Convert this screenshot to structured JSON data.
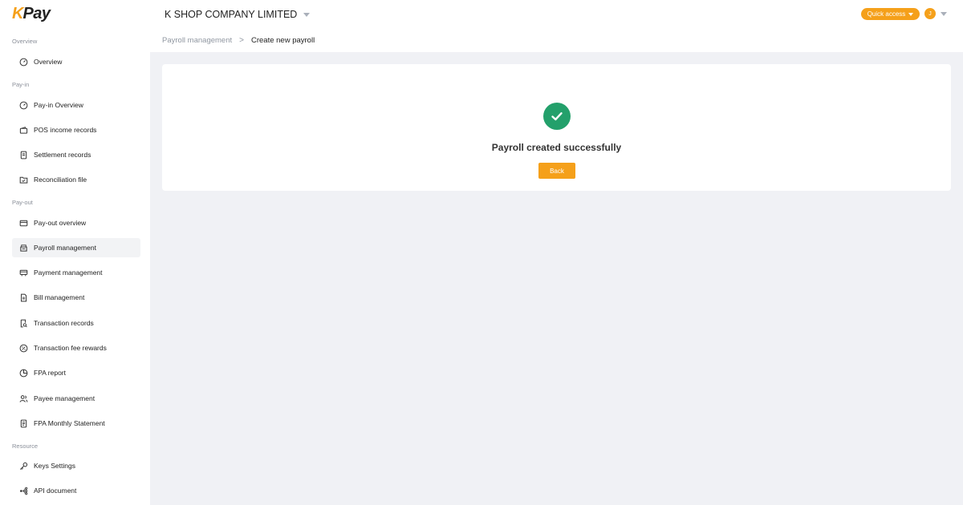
{
  "brand": {
    "logo_k": "K",
    "logo_pay": "Pay",
    "accent": "#f5a01a"
  },
  "header": {
    "company": "K SHOP COMPANY LIMITED",
    "quick_access": "Quick access",
    "avatar_initial": "J"
  },
  "breadcrumb": {
    "parent": "Payroll management",
    "separator": ">",
    "current": "Create new payroll"
  },
  "sidebar": {
    "sections": {
      "overview": "Overview",
      "payin": "Pay-in",
      "payout": "Pay-out",
      "resource": "Resource"
    },
    "items": [
      {
        "label": "Overview",
        "icon": "dashboard-icon"
      },
      {
        "label": "Pay-in Overview",
        "icon": "dashboard-icon"
      },
      {
        "label": "POS income records",
        "icon": "wallet-icon"
      },
      {
        "label": "Settlement records",
        "icon": "document-icon"
      },
      {
        "label": "Reconciliation file",
        "icon": "folder-check-icon"
      },
      {
        "label": "Pay-out overview",
        "icon": "card-icon"
      },
      {
        "label": "Payroll management",
        "icon": "payroll-icon",
        "active": true
      },
      {
        "label": "Payment management",
        "icon": "payment-icon"
      },
      {
        "label": "Bill management",
        "icon": "bill-icon"
      },
      {
        "label": "Transaction records",
        "icon": "search-document-icon"
      },
      {
        "label": "Transaction fee rewards",
        "icon": "reward-icon"
      },
      {
        "label": "FPA report",
        "icon": "pie-chart-icon"
      },
      {
        "label": "Payee management",
        "icon": "users-icon"
      },
      {
        "label": "FPA Monthly Statement",
        "icon": "statement-icon"
      },
      {
        "label": "Keys Settings",
        "icon": "key-icon"
      },
      {
        "label": "API document",
        "icon": "api-icon"
      }
    ]
  },
  "result": {
    "message": "Payroll created successfully",
    "back_label": "Back",
    "status_color": "#23a06b"
  }
}
